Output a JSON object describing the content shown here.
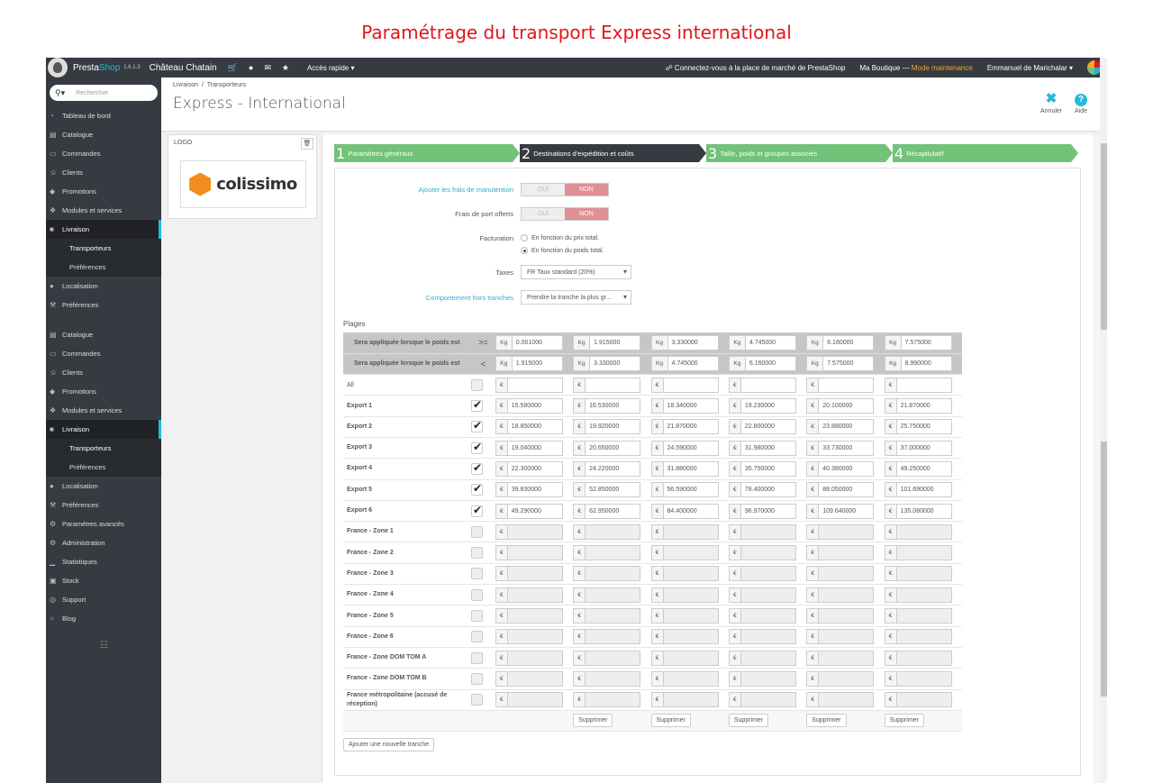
{
  "slide_title": "Paramétrage du transport Express international",
  "topbar": {
    "brand_a": "Presta",
    "brand_b": "Shop",
    "version": "1.6.1.3",
    "shop_name": "Château Chatain",
    "quick_access": "Accès rapide",
    "marketplace": "Connectez-vous à la place de marché de PrestaShop",
    "my_shop": "Ma Boutique",
    "separator": "—",
    "maintenance": "Mode maintenance",
    "user": "Emmanuel de Marichalar"
  },
  "sidebar": {
    "search_placeholder": "Rechercher",
    "items_top": [
      {
        "label": "Tableau de bord",
        "icon": "dashboard-icon"
      },
      {
        "label": "Catalogue",
        "icon": "catalog-icon"
      },
      {
        "label": "Commandes",
        "icon": "orders-icon"
      },
      {
        "label": "Clients",
        "icon": "users-icon"
      },
      {
        "label": "Promotions",
        "icon": "tag-icon"
      },
      {
        "label": "Modules et services",
        "icon": "puzzle-icon"
      },
      {
        "label": "Livraison",
        "icon": "truck-icon"
      },
      {
        "label": "Transporteurs",
        "icon": ""
      },
      {
        "label": "Préférences",
        "icon": ""
      },
      {
        "label": "Localisation",
        "icon": "globe-icon"
      },
      {
        "label": "Préférences",
        "icon": "wrench-icon"
      }
    ],
    "items_bottom": [
      {
        "label": "Catalogue",
        "icon": "catalog-icon"
      },
      {
        "label": "Commandes",
        "icon": "orders-icon"
      },
      {
        "label": "Clients",
        "icon": "users-icon"
      },
      {
        "label": "Promotions",
        "icon": "tag-icon"
      },
      {
        "label": "Modules et services",
        "icon": "puzzle-icon"
      },
      {
        "label": "Livraison",
        "icon": "truck-icon"
      },
      {
        "label": "Transporteurs",
        "icon": ""
      },
      {
        "label": "Préférences",
        "icon": ""
      },
      {
        "label": "Localisation",
        "icon": "globe-icon"
      },
      {
        "label": "Préférences",
        "icon": "wrench-icon"
      },
      {
        "label": "Paramètres avancés",
        "icon": "cogs-icon"
      },
      {
        "label": "Administration",
        "icon": "gear-icon"
      },
      {
        "label": "Statistiques",
        "icon": "chart-icon"
      },
      {
        "label": "Stock",
        "icon": "archive-icon"
      },
      {
        "label": "Support",
        "icon": "lifebuoy-icon"
      },
      {
        "label": "Blog",
        "icon": "comments-icon"
      }
    ]
  },
  "header": {
    "breadcrumb_1": "Livraison",
    "breadcrumb_sep": "/",
    "breadcrumb_2": "Transporteurs",
    "title": "Express - International",
    "cancel_label": "Annuler",
    "help_label": "Aide"
  },
  "logo_panel": {
    "label": "LOGO",
    "brand_text": "colissimo"
  },
  "steps": [
    {
      "num": "1",
      "label": "Paramètres généraux"
    },
    {
      "num": "2",
      "label": "Destinations d'expédition et coûts"
    },
    {
      "num": "3",
      "label": "Taille, poids et groupes associés"
    },
    {
      "num": "4",
      "label": "Récapitulatif"
    }
  ],
  "form": {
    "handling_label": "Ajouter les frais de manutention",
    "free_label": "Frais de port offerts",
    "yes": "OUI",
    "no": "NON",
    "billing_label": "Facturation",
    "billing_price": "En fonction du prix total.",
    "billing_weight": "En fonction du poids total.",
    "tax_label": "Taxes",
    "tax_value": "FR Taux standard (20%)",
    "out_label": "Comportement hors tranches",
    "out_value": "Prendre la tranche la plus gr..."
  },
  "grid": {
    "plages_label": "Plages",
    "range_label": "Sera appliquée lorsque le poids est",
    "op_ge": ">=",
    "op_lt": "<",
    "kg": "Kg",
    "euro": "€",
    "from": [
      "0.001000",
      "1.915000",
      "3.330000",
      "4.745000",
      "6.160000",
      "7.575000"
    ],
    "to": [
      "1.915000",
      "3.330000",
      "4.745000",
      "6.160000",
      "7.575000",
      "8.990000"
    ],
    "all_label": "All",
    "zones": [
      {
        "name": "Export 1",
        "checked": true,
        "prices": [
          "15.580000",
          "16.530000",
          "18.340000",
          "19.230000",
          "20.100000",
          "21.870000"
        ]
      },
      {
        "name": "Export 2",
        "checked": true,
        "prices": [
          "18.850000",
          "19.920000",
          "21.870000",
          "22.800000",
          "23.880000",
          "25.750000"
        ]
      },
      {
        "name": "Export 3",
        "checked": true,
        "prices": [
          "19.040000",
          "20.650000",
          "24.590000",
          "31.980000",
          "33.730000",
          "37.000000"
        ]
      },
      {
        "name": "Export 4",
        "checked": true,
        "prices": [
          "22.300000",
          "24.220000",
          "31.880000",
          "35.750000",
          "40.380000",
          "49.250000"
        ]
      },
      {
        "name": "Export 5",
        "checked": true,
        "prices": [
          "39.830000",
          "52.850000",
          "56.590000",
          "78.400000",
          "88.050000",
          "101.690000"
        ]
      },
      {
        "name": "Export 6",
        "checked": true,
        "prices": [
          "49.290000",
          "62.950000",
          "84.400000",
          "96.970000",
          "109.640000",
          "135.080000"
        ]
      },
      {
        "name": "France - Zone 1",
        "checked": false,
        "prices": [
          "",
          "",
          "",
          "",
          "",
          ""
        ]
      },
      {
        "name": "France - Zone 2",
        "checked": false,
        "prices": [
          "",
          "",
          "",
          "",
          "",
          ""
        ]
      },
      {
        "name": "France - Zone 3",
        "checked": false,
        "prices": [
          "",
          "",
          "",
          "",
          "",
          ""
        ]
      },
      {
        "name": "France - Zone 4",
        "checked": false,
        "prices": [
          "",
          "",
          "",
          "",
          "",
          ""
        ]
      },
      {
        "name": "France - Zone 5",
        "checked": false,
        "prices": [
          "",
          "",
          "",
          "",
          "",
          ""
        ]
      },
      {
        "name": "France - Zone 6",
        "checked": false,
        "prices": [
          "",
          "",
          "",
          "",
          "",
          ""
        ]
      },
      {
        "name": "France - Zone DOM TOM A",
        "checked": false,
        "prices": [
          "",
          "",
          "",
          "",
          "",
          ""
        ]
      },
      {
        "name": "France - Zone DOM TOM B",
        "checked": false,
        "prices": [
          "",
          "",
          "",
          "",
          "",
          ""
        ]
      },
      {
        "name": "France métropolitaine (accusé de réception)",
        "checked": false,
        "prices": [
          "",
          "",
          "",
          "",
          "",
          ""
        ]
      }
    ],
    "delete_label": "Supprimer",
    "add_range_label": "Ajouter une nouvelle tranche"
  }
}
